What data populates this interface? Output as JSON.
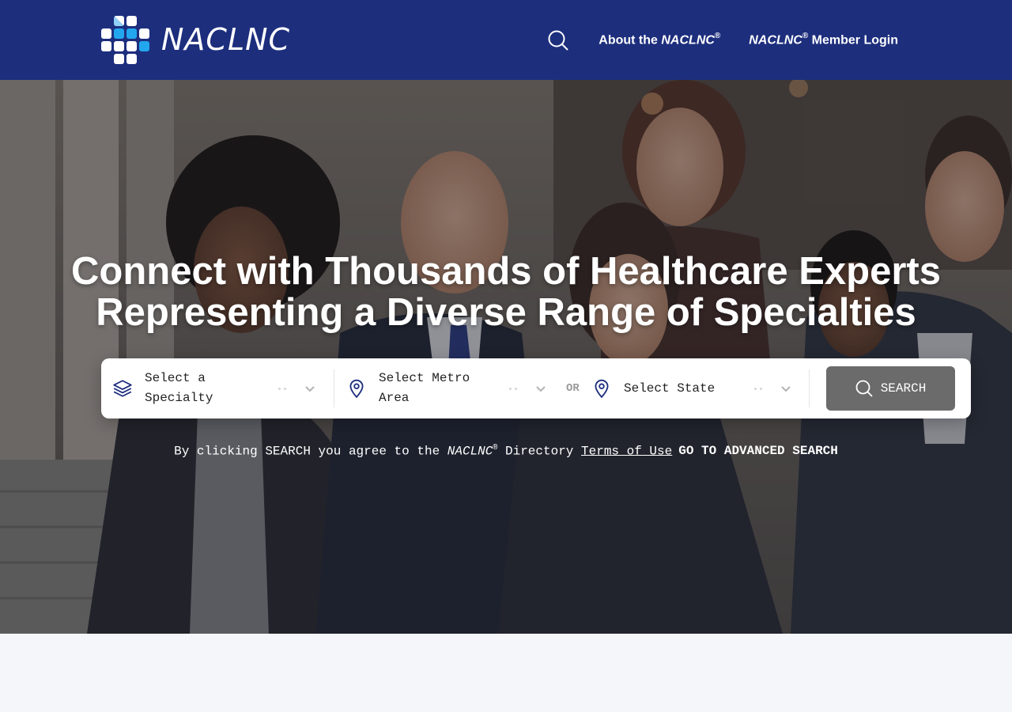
{
  "brand": {
    "name": "NACLNC"
  },
  "header": {
    "search_icon": "search-icon",
    "about_prefix": "About the ",
    "about_brand": "NACLNC",
    "reg": "®",
    "login_brand": "NACLNC",
    "login_suffix": " Member Login"
  },
  "hero": {
    "headline_line1": "Connect with Thousands of Healthcare Experts",
    "headline_line2": "Representing a Diverse Range of Specialties"
  },
  "search": {
    "specialty_label_1": "Select a",
    "specialty_label_2": "Specialty",
    "metro_label_1": "Select Metro",
    "metro_label_2": "Area",
    "or_label": "OR",
    "state_label": "Select State",
    "button_label": "SEARCH"
  },
  "disclaimer": {
    "prefix": "By clicking SEARCH you agree to the ",
    "brand": "NACLNC",
    "reg": "®",
    "middle": " Directory ",
    "terms_link": "Terms of Use",
    "advanced_link": "GO TO ADVANCED SEARCH"
  },
  "colors": {
    "header_bg": "#1d2e7d",
    "logo_accent": "#22a7ee",
    "search_button_bg": "#6b6b6b",
    "page_bg": "#f5f6fa"
  }
}
